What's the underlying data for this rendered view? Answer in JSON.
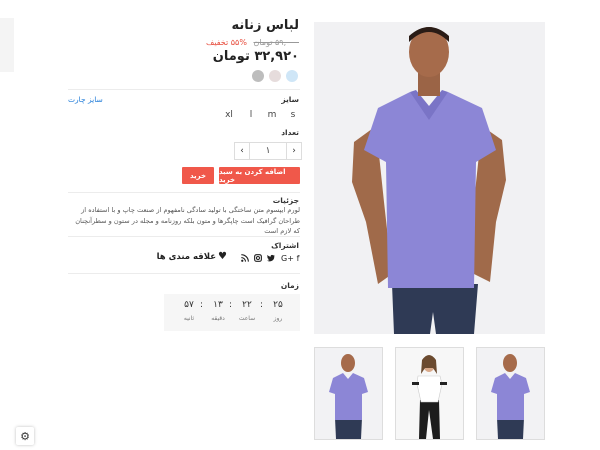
{
  "product": {
    "title": "لباس زنانه",
    "old_price": "۵۹,۰۰۰ تومان",
    "discount": "%۵۵ تخفیف",
    "price": "۳۲,۹۲۰ تومان"
  },
  "colors": [
    "#bdbdbd",
    "#e6dcdc",
    "#cfe6f7"
  ],
  "size": {
    "label": "سایز",
    "chart_link": "سایز چارت",
    "options": [
      "xl",
      "l",
      "m",
      "s"
    ]
  },
  "quantity": {
    "label": "تعداد",
    "value": "۱",
    "dec": "‹",
    "inc": "›"
  },
  "buttons": {
    "add_to_cart": "اضافه کردن به سبد خرید",
    "buy": "خرید"
  },
  "details": {
    "heading": "جزئیات",
    "text": "لورم ایپسوم متن ساختگی با تولید سادگی نامفهوم از صنعت چاپ و با استفاده از طراحان گرافیک است چاپگرها و متون بلکه روزنامه و مجله در ستون و سطرآنچنان که لازم است"
  },
  "share": {
    "heading": "اشتراک",
    "icons": [
      "facebook-icon",
      "google-plus-icon",
      "twitter-icon",
      "instagram-icon",
      "rss-icon"
    ],
    "favorite_label": "علاقه مندی ها"
  },
  "timer": {
    "heading": "زمان",
    "days": "۲۵",
    "hours": "۲۲",
    "minutes": "۱۳",
    "seconds": "۵۷",
    "days_label": "روز",
    "hours_label": "ساعت",
    "minutes_label": "دقیقه",
    "seconds_label": "ثانیه"
  },
  "images": {
    "main": "man-purple-polo",
    "thumbs": [
      "man-purple-polo",
      "woman-white-top",
      "man-purple-polo"
    ]
  }
}
